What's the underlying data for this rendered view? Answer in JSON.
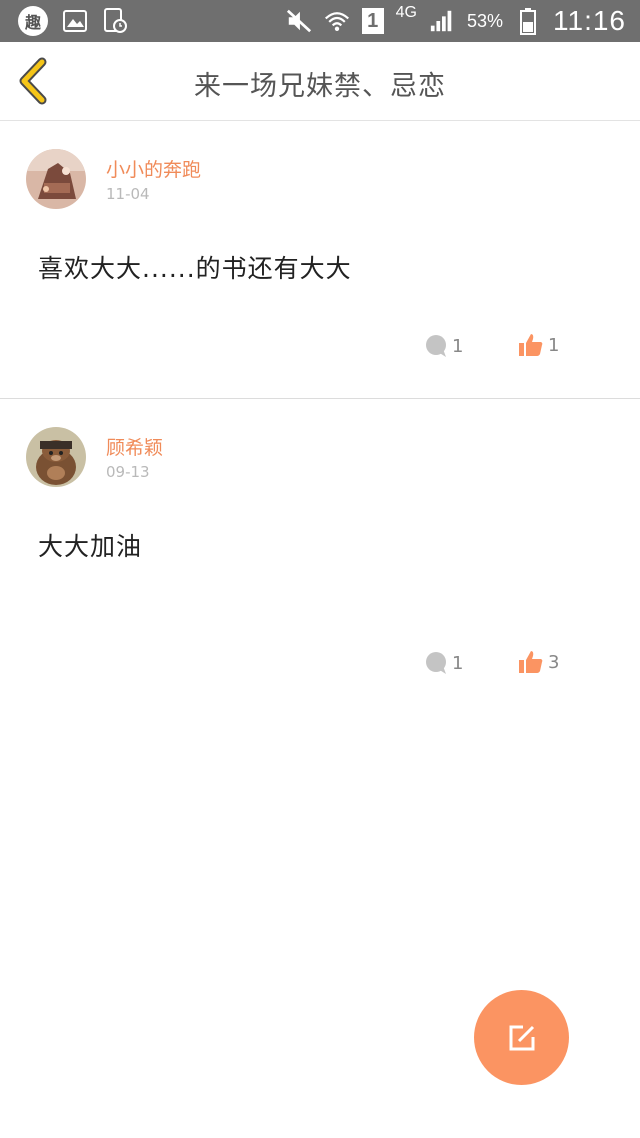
{
  "status_bar": {
    "app_glyph": "趣",
    "network": "4G",
    "sim": "1",
    "battery": "53%",
    "time": "11:16",
    "icons": [
      "image-icon",
      "clock-icon",
      "mute-icon",
      "wifi-icon",
      "signal-icon",
      "battery-icon"
    ]
  },
  "header": {
    "title": "来一场兄妹禁、忌恋",
    "back_icon": "chevron-left-icon"
  },
  "posts": [
    {
      "username": "小小的奔跑",
      "date": "11-04",
      "content": "喜欢大大......的书还有大大",
      "comment_count": "1",
      "like_count": "1"
    },
    {
      "username": "顾希颖",
      "date": "09-13",
      "content": "大大加油",
      "comment_count": "1",
      "like_count": "3"
    }
  ],
  "fab": {
    "icon": "edit-icon"
  },
  "colors": {
    "accent": "#fb9462",
    "username": "#f08b59",
    "back_chevron": "#f5c518",
    "status_bar": "#6f6f6f"
  }
}
